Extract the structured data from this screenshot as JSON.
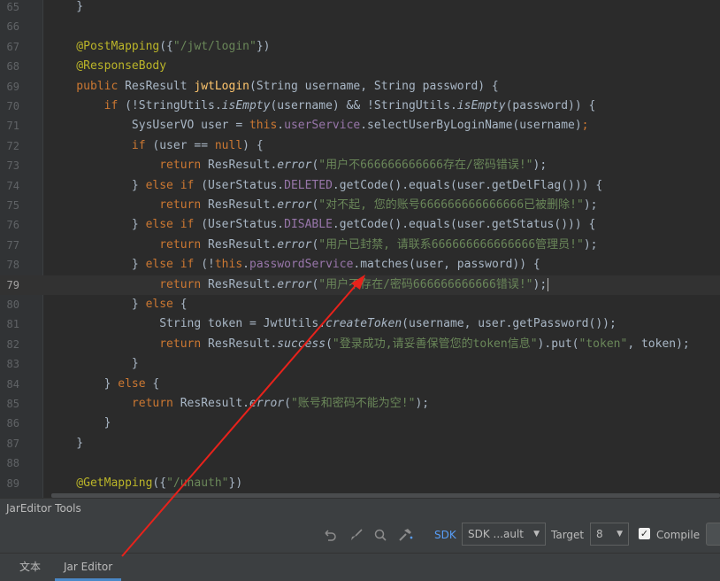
{
  "editor": {
    "current_line": "79",
    "lines": [
      {
        "n": "65",
        "seg": [
          [
            "p",
            "    }"
          ]
        ]
      },
      {
        "n": "66",
        "seg": []
      },
      {
        "n": "67",
        "seg": [
          [
            "a",
            "    @PostMapping"
          ],
          [
            "p",
            "({"
          ],
          [
            "s",
            "\"/jwt/login\""
          ],
          [
            "p",
            "})"
          ]
        ]
      },
      {
        "n": "68",
        "seg": [
          [
            "a",
            "    @ResponseBody"
          ]
        ]
      },
      {
        "n": "69",
        "seg": [
          [
            "k",
            "    public "
          ],
          [
            "p",
            "ResResult "
          ],
          [
            "f",
            "jwtLogin"
          ],
          [
            "p",
            "(String username, String password) {"
          ]
        ]
      },
      {
        "n": "70",
        "seg": [
          [
            "k",
            "        if "
          ],
          [
            "p",
            "(!StringUtils."
          ],
          [
            "i",
            "isEmpty"
          ],
          [
            "p",
            "(username) && !StringUtils."
          ],
          [
            "i",
            "isEmpty"
          ],
          [
            "p",
            "(password)) {"
          ]
        ]
      },
      {
        "n": "71",
        "seg": [
          [
            "p",
            "            SysUserVO user = "
          ],
          [
            "k",
            "this"
          ],
          [
            "p",
            "."
          ],
          [
            "d",
            "userService"
          ],
          [
            "p",
            ".selectUserByLoginName(username)"
          ],
          [
            "k",
            ";"
          ]
        ]
      },
      {
        "n": "72",
        "seg": [
          [
            "k",
            "            if "
          ],
          [
            "p",
            "(user == "
          ],
          [
            "k",
            "null"
          ],
          [
            "p",
            ") {"
          ]
        ]
      },
      {
        "n": "73",
        "seg": [
          [
            "k",
            "                return "
          ],
          [
            "p",
            "ResResult."
          ],
          [
            "i",
            "error"
          ],
          [
            "p",
            "("
          ],
          [
            "s",
            "\"用户不666666666666存在/密码错误!\""
          ],
          [
            "p",
            ");"
          ]
        ]
      },
      {
        "n": "74",
        "seg": [
          [
            "p",
            "            } "
          ],
          [
            "k",
            "else if "
          ],
          [
            "p",
            "(UserStatus."
          ],
          [
            "d",
            "DELETED"
          ],
          [
            "p",
            ".getCode().equals(user.getDelFlag())) {"
          ]
        ]
      },
      {
        "n": "75",
        "seg": [
          [
            "k",
            "                return "
          ],
          [
            "p",
            "ResResult."
          ],
          [
            "i",
            "error"
          ],
          [
            "p",
            "("
          ],
          [
            "s",
            "\"对不起, 您的账号666666666666666已被删除!\""
          ],
          [
            "p",
            ");"
          ]
        ]
      },
      {
        "n": "76",
        "seg": [
          [
            "p",
            "            } "
          ],
          [
            "k",
            "else if "
          ],
          [
            "p",
            "(UserStatus."
          ],
          [
            "d",
            "DISABLE"
          ],
          [
            "p",
            ".getCode().equals(user.getStatus())) {"
          ]
        ]
      },
      {
        "n": "77",
        "seg": [
          [
            "k",
            "                return "
          ],
          [
            "p",
            "ResResult."
          ],
          [
            "i",
            "error"
          ],
          [
            "p",
            "("
          ],
          [
            "s",
            "\"用户已封禁, 请联系666666666666666管理员!\""
          ],
          [
            "p",
            ");"
          ]
        ]
      },
      {
        "n": "78",
        "seg": [
          [
            "p",
            "            } "
          ],
          [
            "k",
            "else if "
          ],
          [
            "p",
            "(!"
          ],
          [
            "k",
            "this"
          ],
          [
            "p",
            "."
          ],
          [
            "d",
            "passwordService"
          ],
          [
            "p",
            ".matches(user, password)) {"
          ]
        ]
      },
      {
        "n": "79",
        "seg": [
          [
            "k",
            "                return "
          ],
          [
            "p",
            "ResResult."
          ],
          [
            "i",
            "error"
          ],
          [
            "p",
            "("
          ],
          [
            "s",
            "\"用户不存在/密码666666666666错误!\""
          ],
          [
            "p",
            ");"
          ]
        ]
      },
      {
        "n": "80",
        "seg": [
          [
            "p",
            "            } "
          ],
          [
            "k",
            "else "
          ],
          [
            "p",
            "{"
          ]
        ]
      },
      {
        "n": "81",
        "seg": [
          [
            "p",
            "                String token = JwtUtils."
          ],
          [
            "i",
            "createToken"
          ],
          [
            "p",
            "(username, user.getPassword());"
          ]
        ]
      },
      {
        "n": "82",
        "seg": [
          [
            "k",
            "                return "
          ],
          [
            "p",
            "ResResult."
          ],
          [
            "i",
            "success"
          ],
          [
            "p",
            "("
          ],
          [
            "s",
            "\"登录成功,请妥善保管您的token信息\""
          ],
          [
            "p",
            ").put("
          ],
          [
            "s",
            "\"token\""
          ],
          [
            "p",
            ", token);"
          ]
        ]
      },
      {
        "n": "83",
        "seg": [
          [
            "p",
            "            }"
          ]
        ]
      },
      {
        "n": "84",
        "seg": [
          [
            "p",
            "        } "
          ],
          [
            "k",
            "else "
          ],
          [
            "p",
            "{"
          ]
        ]
      },
      {
        "n": "85",
        "seg": [
          [
            "k",
            "            return "
          ],
          [
            "p",
            "ResResult."
          ],
          [
            "i",
            "error"
          ],
          [
            "p",
            "("
          ],
          [
            "s",
            "\"账号和密码不能为空!\""
          ],
          [
            "p",
            ");"
          ]
        ]
      },
      {
        "n": "86",
        "seg": [
          [
            "p",
            "        }"
          ]
        ]
      },
      {
        "n": "87",
        "seg": [
          [
            "p",
            "    }"
          ]
        ]
      },
      {
        "n": "88",
        "seg": []
      },
      {
        "n": "89",
        "seg": [
          [
            "a",
            "    @GetMapping"
          ],
          [
            "p",
            "({"
          ],
          [
            "s",
            "\"/unauth\""
          ],
          [
            "p",
            "})"
          ]
        ]
      }
    ]
  },
  "tools_panel": {
    "title": "JarEditor Tools",
    "icons": [
      "undo-icon",
      "brush-icon",
      "search-icon",
      "build-icon"
    ],
    "sdk_label": "SDK",
    "sdk_value": "SDK ...ault",
    "target_label": "Target",
    "target_value": "8",
    "compile_label": "Compile",
    "compile_checked": true
  },
  "tabs": [
    {
      "label": "文本",
      "active": false
    },
    {
      "label": "Jar Editor",
      "active": true
    }
  ],
  "annotation": {
    "arrow_color": "#e8221b"
  }
}
